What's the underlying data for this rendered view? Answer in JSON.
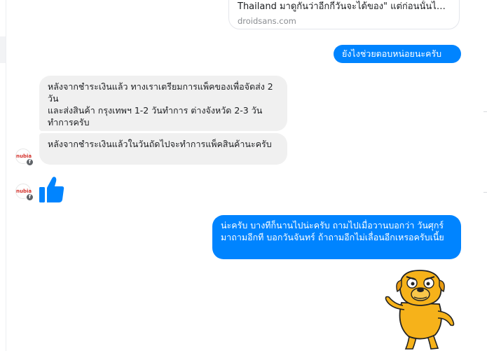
{
  "link_preview": {
    "title": "Thailand มาดูกันว่าอีกกี่วันจะได้ของ\" แต่ก่อนนั้นไม่...",
    "domain": "droidsans.com"
  },
  "messages": {
    "out_1": "ยังไงช่วยตอบหน่อยนะครับ",
    "in_1": "หลังจากชำระเงินแล้ว  ทางเราเตรียมการแพ็คของเพื่อจัดส่ง 2 วัน\nและส่งสินค้า กรุงเทพฯ 1-2 วันทำการ ต่างจังหวัด 2-3 วันทำการครับ",
    "in_2": "หลังจากชำระเงินแล้วในวันถัดไปจะทำการแพ็คสินค้านะครับ",
    "out_2": "น่ะครับ บางทีก็นานไปน่ะครับ ถามไปเมื่อวานบอกว่า วันศุกร์ มาถามอีกที บอกวันจันทร์ ถ้าถามอีกไม่เลื่อนอีกเหรอครับเนี้ย"
  },
  "avatar": {
    "label": "nubia",
    "badge": "f"
  },
  "colors": {
    "outgoing": "#0084ff",
    "incoming": "#f0f0f0",
    "thumb": "#0084ff",
    "sticker": "#f6b21a"
  },
  "icons": {
    "thumb": "thumbs-up-icon",
    "sticker": "jake-the-dog-sticker"
  }
}
